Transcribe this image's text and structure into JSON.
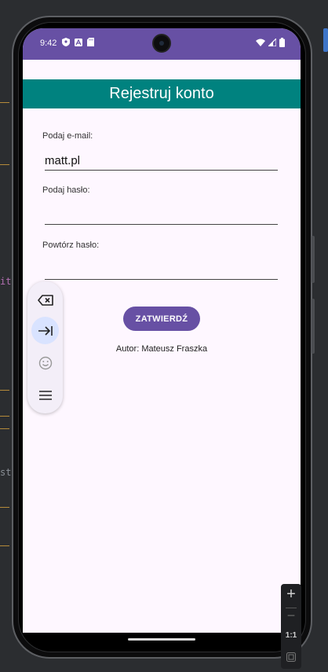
{
  "status_bar": {
    "time": "9:42",
    "left_icons": [
      "shield-icon",
      "translate-icon",
      "sd-card-icon"
    ],
    "right_icons": [
      "wifi-icon",
      "signal-icon",
      "battery-icon"
    ],
    "color": "#6750a4"
  },
  "app": {
    "title": "Rejestruj konto",
    "title_bar_color": "#00827f",
    "email": {
      "label": "Podaj e-mail:",
      "value": "matt.pl"
    },
    "password": {
      "label": "Podaj hasło:",
      "value": ""
    },
    "password_repeat": {
      "label": "Powtórz hasło:",
      "value": ""
    },
    "submit_label": "ZATWIERDŹ",
    "author": "Autor: Mateusz Fraszka"
  },
  "keyboard_toolbar": {
    "buttons": [
      "backspace-icon",
      "tab-icon",
      "emoji-icon",
      "menu-icon"
    ],
    "active": "tab-icon"
  },
  "zoom_controls": {
    "zoom_in": "+",
    "zoom_out": "−",
    "ratio": "1:1"
  },
  "ide_fragments": [
    "it",
    "st"
  ]
}
